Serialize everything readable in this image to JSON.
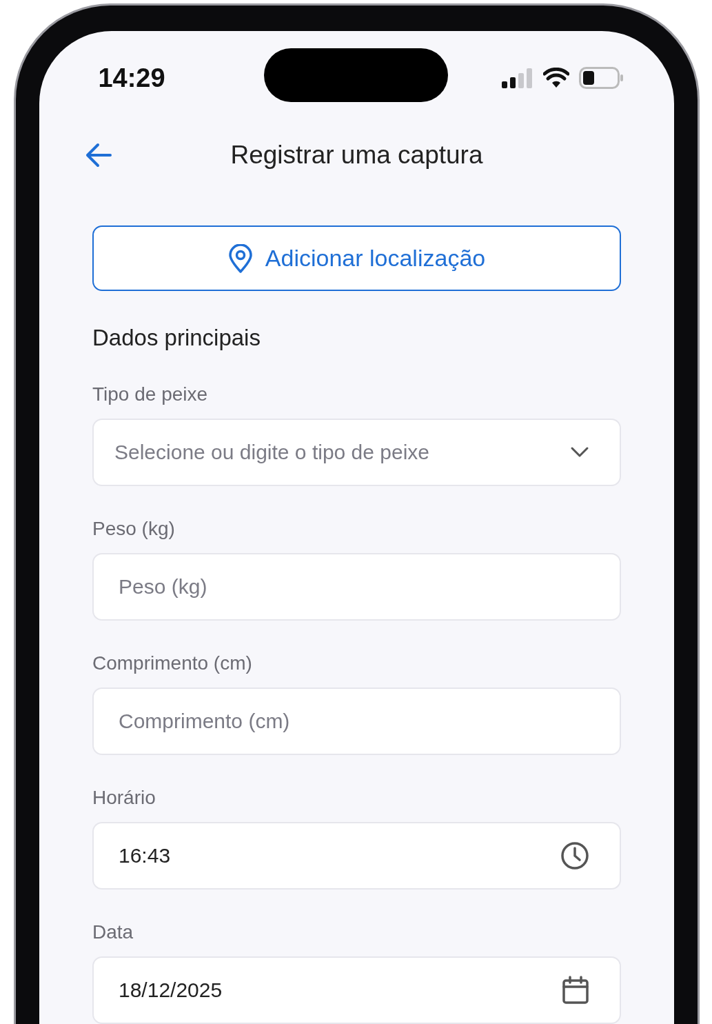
{
  "status_bar": {
    "time": "14:29"
  },
  "header": {
    "title": "Registrar uma captura"
  },
  "location_button": {
    "label": "Adicionar localização"
  },
  "section": {
    "title": "Dados principais"
  },
  "fields": [
    {
      "kind": "select",
      "label": "Tipo de peixe",
      "placeholder": "Selecione ou digite o tipo de peixe"
    },
    {
      "kind": "text",
      "label": "Peso (kg)",
      "placeholder": "Peso (kg)"
    },
    {
      "kind": "text",
      "label": "Comprimento (cm)",
      "placeholder": "Comprimento (cm)"
    },
    {
      "kind": "time",
      "label": "Horário",
      "value": "16:43"
    },
    {
      "kind": "date",
      "label": "Data",
      "value": "18/12/2025"
    }
  ]
}
